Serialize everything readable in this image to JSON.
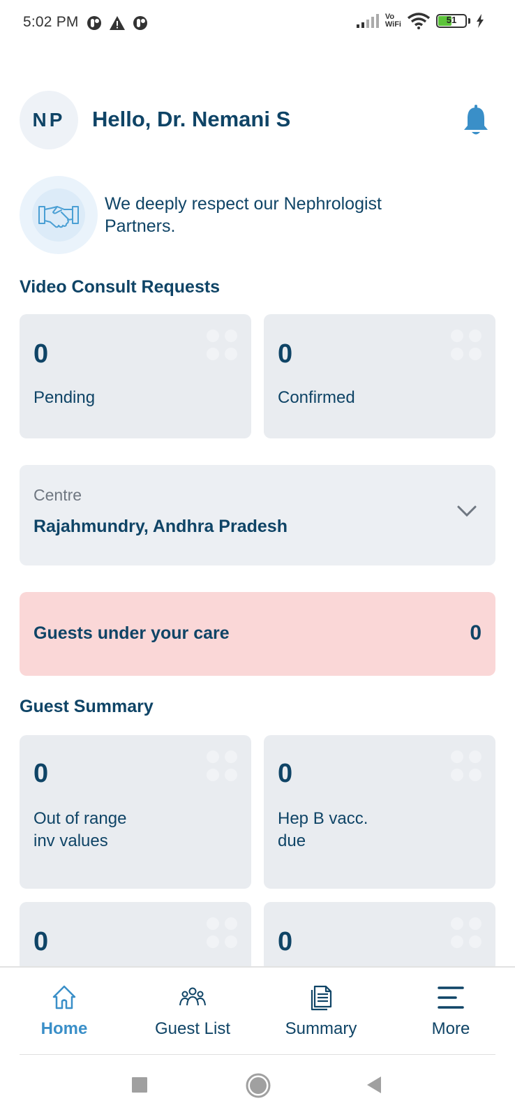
{
  "status_bar": {
    "time": "5:02 PM",
    "left_icons": [
      "data-saver-icon",
      "warning-icon",
      "data-saver-icon"
    ],
    "vowifi_label_top": "Vo",
    "vowifi_label_bottom": "WiFi",
    "battery_level": "51",
    "battery_percent": 51,
    "charging": true
  },
  "header": {
    "avatar_initials": "NP",
    "greeting": "Hello, Dr. Nemani S",
    "notification_icon": "bell-icon",
    "accent_color": "#3a8fc8"
  },
  "respect_banner": {
    "icon": "handshake-icon",
    "text": "We deeply respect our Nephrologist Partners."
  },
  "video_consult": {
    "title": "Video Consult Requests",
    "cards": [
      {
        "value": "0",
        "label": "Pending"
      },
      {
        "value": "0",
        "label": "Confirmed"
      }
    ]
  },
  "centre": {
    "label": "Centre",
    "value": "Rajahmundry, Andhra Pradesh"
  },
  "guests_under_care": {
    "label": "Guests under your care",
    "count": "0",
    "background_color": "#fad7d7"
  },
  "guest_summary": {
    "title": "Guest Summary",
    "cards": [
      {
        "value": "0",
        "label_line1": "Out of range",
        "label_line2": "inv values"
      },
      {
        "value": "0",
        "label_line1": "Hep B vacc.",
        "label_line2": "due"
      },
      {
        "value": "0"
      },
      {
        "value": "0"
      }
    ]
  },
  "bottom_nav": {
    "items": [
      {
        "label": "Home",
        "icon": "home-icon",
        "active": true
      },
      {
        "label": "Guest List",
        "icon": "users-icon",
        "active": false
      },
      {
        "label": "Summary",
        "icon": "document-icon",
        "active": false
      },
      {
        "label": "More",
        "icon": "menu-icon",
        "active": false
      }
    ]
  },
  "system_nav": {
    "buttons": [
      "recents-button",
      "home-button",
      "back-button"
    ]
  }
}
